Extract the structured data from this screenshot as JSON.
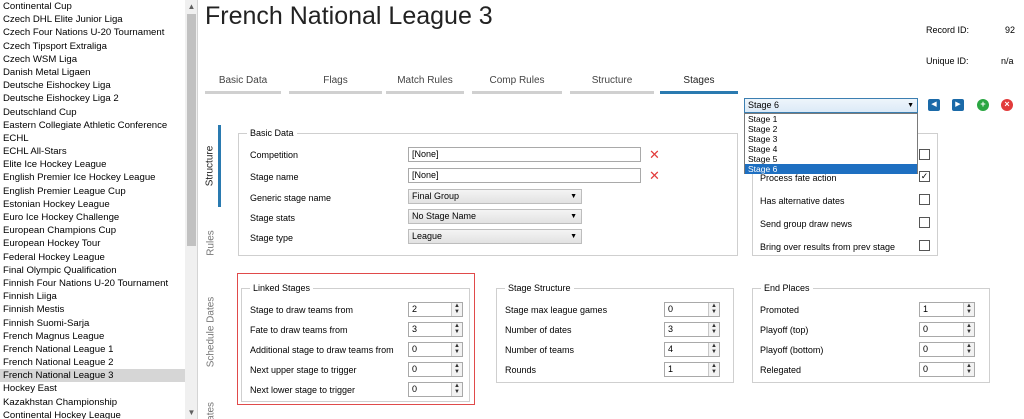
{
  "left_list": {
    "items": [
      "Continental Cup",
      "Czech DHL Elite Junior Liga",
      "Czech Four Nations U-20 Tournament",
      "Czech Tipsport Extraliga",
      "Czech WSM Liga",
      "Danish Metal Ligaen",
      "Deutsche Eishockey Liga",
      "Deutsche Eishockey Liga 2",
      "Deutschland Cup",
      "Eastern Collegiate Athletic Conference",
      "ECHL",
      "ECHL All-Stars",
      "Elite Ice Hockey League",
      "English Premier Ice Hockey League",
      "English Premier League Cup",
      "Estonian Hockey League",
      "Euro Ice Hockey Challenge",
      "European Champions Cup",
      "European Hockey Tour",
      "Federal Hockey League",
      "Final Olympic Qualification",
      "Finnish Four Nations U-20 Tournament",
      "Finnish Liiga",
      "Finnish Mestis",
      "Finnish Suomi-Sarja",
      "French Magnus League",
      "French National League 1",
      "French National League 2",
      "French National League 3",
      "Hockey East",
      "Kazakhstan Championship",
      "Continental Hockey League"
    ],
    "selected_index": 28
  },
  "header": {
    "title": "French National League 3",
    "record_id_label": "Record ID:",
    "record_id_value": "92",
    "unique_id_label": "Unique ID:",
    "unique_id_value": "n/a"
  },
  "tabs": [
    "Basic Data",
    "Flags",
    "Match Rules",
    "Comp Rules",
    "Structure",
    "Stages"
  ],
  "active_tab": "Stages",
  "stage_selector": {
    "value": "Stage 6",
    "options": [
      "Stage 1",
      "Stage 2",
      "Stage 3",
      "Stage 4",
      "Stage 5",
      "Stage 6"
    ],
    "selected_index": 5
  },
  "side_tabs": [
    "Structure",
    "Rules",
    "Schedule Dates",
    "Dates"
  ],
  "basic_data": {
    "title": "Basic Data",
    "competition_label": "Competition",
    "competition_value": "[None]",
    "stage_name_label": "Stage name",
    "stage_name_value": "[None]",
    "generic_stage_name_label": "Generic stage name",
    "generic_stage_name_value": "Final Group",
    "stage_stats_label": "Stage stats",
    "stage_stats_value": "No Stage Name",
    "stage_type_label": "Stage type",
    "stage_type_value": "League"
  },
  "flags": {
    "process_fate_action_label": "Process fate action",
    "process_fate_action_checked": true,
    "alternative_dates_label": "Has alternative dates",
    "alternative_dates_checked": false,
    "group_draw_news_label": "Send group draw news",
    "group_draw_news_checked": false,
    "bring_over_results_label": "Bring over results from prev stage",
    "bring_over_results_checked": false,
    "top_checked": false
  },
  "linked_stages": {
    "title": "Linked Stages",
    "rows": [
      {
        "label": "Stage to draw teams from",
        "value": "2"
      },
      {
        "label": "Fate to draw teams from",
        "value": "3"
      },
      {
        "label": "Additional stage to draw teams from",
        "value": "0"
      },
      {
        "label": "Next upper stage to trigger",
        "value": "0"
      },
      {
        "label": "Next lower stage to trigger",
        "value": "0"
      }
    ]
  },
  "stage_structure": {
    "title": "Stage Structure",
    "rows": [
      {
        "label": "Stage max league games",
        "value": "0"
      },
      {
        "label": "Number of dates",
        "value": "3"
      },
      {
        "label": "Number of teams",
        "value": "4"
      },
      {
        "label": "Rounds",
        "value": "1"
      }
    ]
  },
  "end_places": {
    "title": "End Places",
    "rows": [
      {
        "label": "Promoted",
        "value": "1"
      },
      {
        "label": "Playoff (top)",
        "value": "0"
      },
      {
        "label": "Playoff (bottom)",
        "value": "0"
      },
      {
        "label": "Relegated",
        "value": "0"
      }
    ]
  },
  "colors": {
    "accent": "#2a7ab0",
    "nav_blue": "#1b6aa8",
    "add_green": "#2aa642",
    "delete_red": "#e23b3b",
    "selection": "#1e6fc1"
  },
  "icons": {
    "prev": "arrow-left-icon",
    "next": "arrow-right-icon",
    "add": "plus-circle-icon",
    "delete": "x-circle-icon",
    "clear": "x-icon"
  }
}
